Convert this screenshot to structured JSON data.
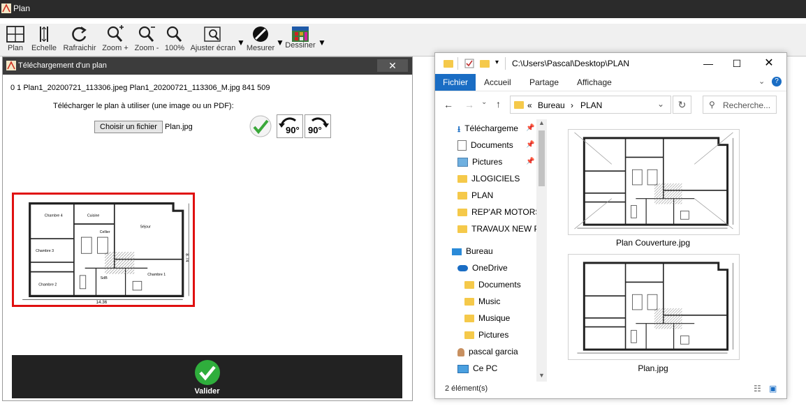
{
  "app": {
    "title": "Plan"
  },
  "toolbar": {
    "plan": "Plan",
    "echelle": "Echelle",
    "rafraichir": "Rafraichir",
    "zoom_in": "Zoom +",
    "zoom_out": "Zoom -",
    "zoom_100": "100%",
    "fit": "Ajuster écran",
    "measure": "Mesurer",
    "draw": "Dessiner"
  },
  "dialog": {
    "title": "Téléchargement d'un plan",
    "close": "✕",
    "file_info": "0 1 Plan1_20200721_113306.jpeg Plan1_20200721_113306_M.jpg 841 509",
    "upload_label": "Télécharger le plan à utiliser (une image ou un PDF):",
    "choose_button": "Choisir un fichier",
    "file_name": "Plan.jpg",
    "rotate_left": "90°",
    "rotate_right": "90°",
    "validate": "Valider"
  },
  "plan": {
    "rooms": [
      "Chambre 4",
      "Cuisine",
      "Séjour",
      "Chambre 3",
      "Cellier",
      "SdB",
      "Chambre 2",
      "Chambre 1"
    ],
    "dims": [
      "14.36",
      "8.74"
    ]
  },
  "explorer": {
    "path": "C:\\Users\\Pascal\\Desktop\\PLAN",
    "tabs": [
      "Fichier",
      "Accueil",
      "Partage",
      "Affichage"
    ],
    "breadcrumb": [
      "«",
      "Bureau",
      "›",
      "PLAN"
    ],
    "search_placeholder": "Recherche...",
    "nav": [
      {
        "label": "Téléchargeme",
        "icon": "download-icon"
      },
      {
        "label": "Documents",
        "icon": "document-icon"
      },
      {
        "label": "Pictures",
        "icon": "pictures-icon"
      },
      {
        "label": "JLOGICIELS",
        "icon": "folder-icon"
      },
      {
        "label": "PLAN",
        "icon": "folder-icon"
      },
      {
        "label": "REP'AR MOTORS",
        "icon": "folder-icon"
      },
      {
        "label": "TRAVAUX NEW PA",
        "icon": "folder-icon"
      },
      {
        "label": "Bureau",
        "icon": "desktop-icon"
      },
      {
        "label": "OneDrive",
        "icon": "cloud-icon"
      },
      {
        "label": "Documents",
        "icon": "folder-icon"
      },
      {
        "label": "Music",
        "icon": "folder-icon"
      },
      {
        "label": "Musique",
        "icon": "folder-icon"
      },
      {
        "label": "Pictures",
        "icon": "folder-icon"
      },
      {
        "label": "pascal garcia",
        "icon": "user-icon"
      },
      {
        "label": "Ce PC",
        "icon": "computer-icon"
      }
    ],
    "files": [
      "Plan Couverture.jpg",
      "Plan.jpg"
    ],
    "status": "2 élément(s)"
  },
  "colors": {
    "accent": "#1a6dc4",
    "highlight": "#e01010",
    "dark": "#222222"
  }
}
